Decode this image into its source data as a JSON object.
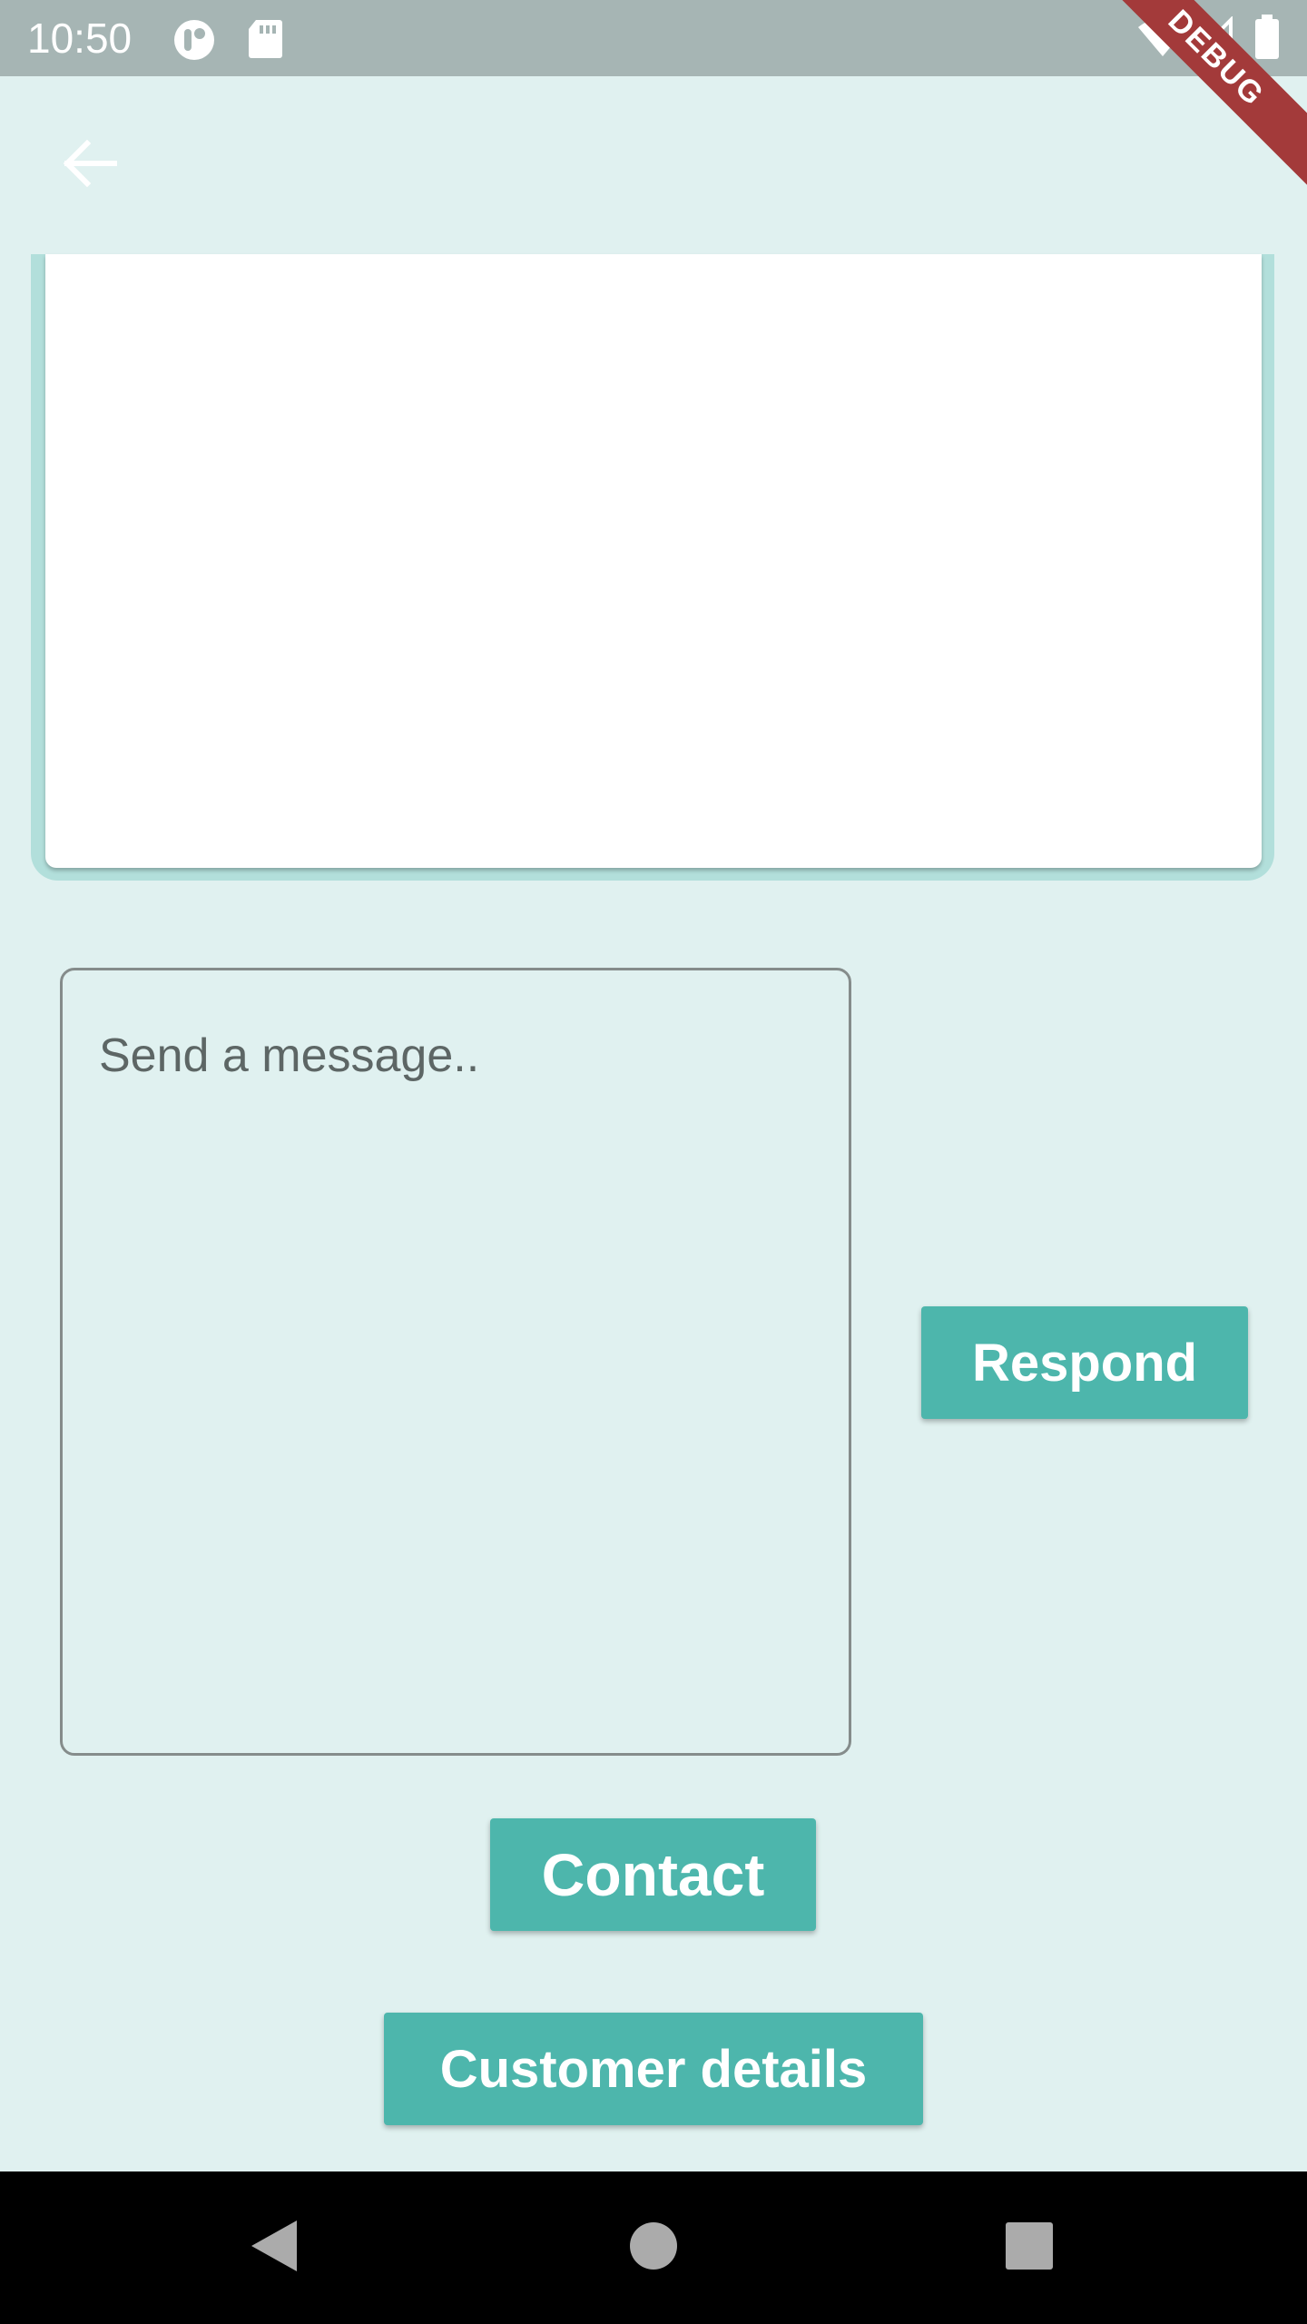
{
  "status_bar": {
    "time": "10:50",
    "icons": [
      "notification-app-icon",
      "sd-card-icon",
      "wifi-icon",
      "cell-signal-icon",
      "battery-icon"
    ],
    "debug_label": "DEBUG",
    "background_color": "#a6b5b4"
  },
  "app_bar": {
    "back_icon": "arrow-back-icon"
  },
  "compose": {
    "placeholder": "Send a message..",
    "value": ""
  },
  "actions": {
    "respond_label": "Respond",
    "contact_label": "Contact",
    "customer_details_label": "Customer details"
  },
  "nav_bar": {
    "items": [
      "back-triangle-icon",
      "home-circle-icon",
      "recents-square-icon"
    ]
  },
  "colors": {
    "background": "#e0f1f0",
    "accent": "#4db6ac",
    "panel_border": "#b2dfdb",
    "debug_banner": "#a33a3a"
  }
}
